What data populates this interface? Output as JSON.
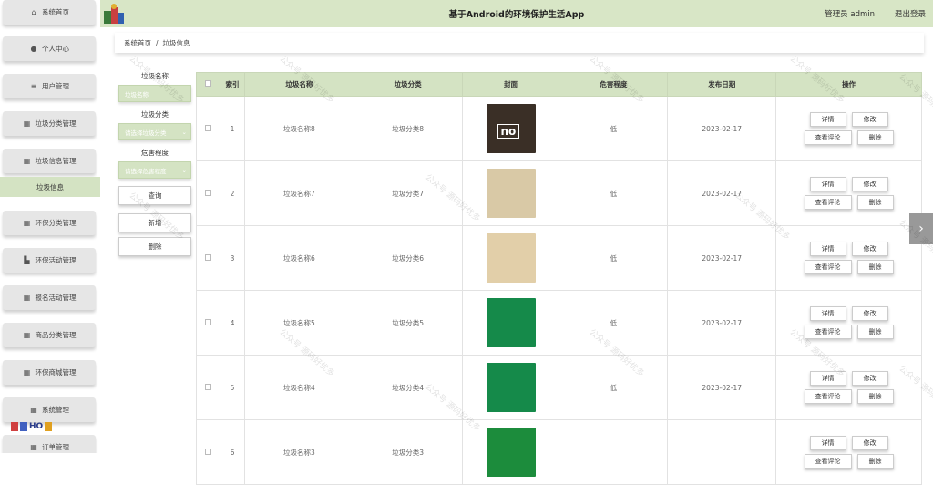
{
  "header": {
    "title": "基于Android的环境保护生活App",
    "user": "管理员 admin",
    "logout": "退出登录"
  },
  "sidebar": {
    "items": [
      {
        "label": "系统首页",
        "icon": "home-icon"
      },
      {
        "label": "个人中心",
        "icon": "person-icon"
      },
      {
        "label": "用户管理",
        "icon": "list-icon"
      },
      {
        "label": "垃圾分类管理",
        "icon": "grid-icon"
      },
      {
        "label": "垃圾信息管理",
        "icon": "grid-icon"
      },
      {
        "label": "垃圾信息",
        "icon": ""
      },
      {
        "label": "环保分类管理",
        "icon": "grid-icon"
      },
      {
        "label": "环保活动管理",
        "icon": "chart-icon"
      },
      {
        "label": "报名活动管理",
        "icon": "table-icon"
      },
      {
        "label": "商品分类管理",
        "icon": "grid-icon"
      },
      {
        "label": "环保商城管理",
        "icon": "grid-icon"
      },
      {
        "label": "系统管理",
        "icon": "grid-icon"
      },
      {
        "label": "订单管理",
        "icon": "grid-icon"
      }
    ]
  },
  "breadcrumb": {
    "home": "系统首页",
    "separator": "/",
    "current": "垃圾信息"
  },
  "filter": {
    "name_label": "垃圾名称",
    "name_placeholder": "垃圾名称",
    "category_label": "垃圾分类",
    "category_placeholder": "请选择垃圾分类",
    "harm_label": "危害程度",
    "harm_placeholder": "请选择危害程度",
    "query_button": "查询",
    "add_button": "新增",
    "delete_button": "删除"
  },
  "table": {
    "headers": [
      "",
      "索引",
      "垃圾名称",
      "垃圾分类",
      "封面",
      "危害程度",
      "发布日期",
      "操作"
    ],
    "rows": [
      {
        "index": "1",
        "name": "垃圾名称8",
        "category": "垃圾分类8",
        "harm": "低",
        "date": "2023-02-17",
        "thumb_text": "no",
        "thumb_color": "#3a2f26"
      },
      {
        "index": "2",
        "name": "垃圾名称7",
        "category": "垃圾分类7",
        "harm": "低",
        "date": "2023-02-17",
        "thumb_text": "",
        "thumb_color": "#d9c9a6"
      },
      {
        "index": "3",
        "name": "垃圾名称6",
        "category": "垃圾分类6",
        "harm": "低",
        "date": "2023-02-17",
        "thumb_text": "",
        "thumb_color": "#e2cfa9"
      },
      {
        "index": "4",
        "name": "垃圾名称5",
        "category": "垃圾分类5",
        "harm": "低",
        "date": "2023-02-17",
        "thumb_text": "",
        "thumb_color": "#158a4a"
      },
      {
        "index": "5",
        "name": "垃圾名称4",
        "category": "垃圾分类4",
        "harm": "低",
        "date": "2023-02-17",
        "thumb_text": "",
        "thumb_color": "#158a4a"
      },
      {
        "index": "6",
        "name": "垃圾名称3",
        "category": "垃圾分类3",
        "harm": "",
        "date": "",
        "thumb_text": "",
        "thumb_color": "#1c8c3c"
      }
    ],
    "actions": {
      "detail": "详情",
      "edit": "修改",
      "comments": "查看评论",
      "delete": "删除"
    }
  },
  "watermark": "公众号 源码好优多",
  "colors": {
    "accent": "#d4e3c3",
    "header": "#d8e6c6"
  }
}
